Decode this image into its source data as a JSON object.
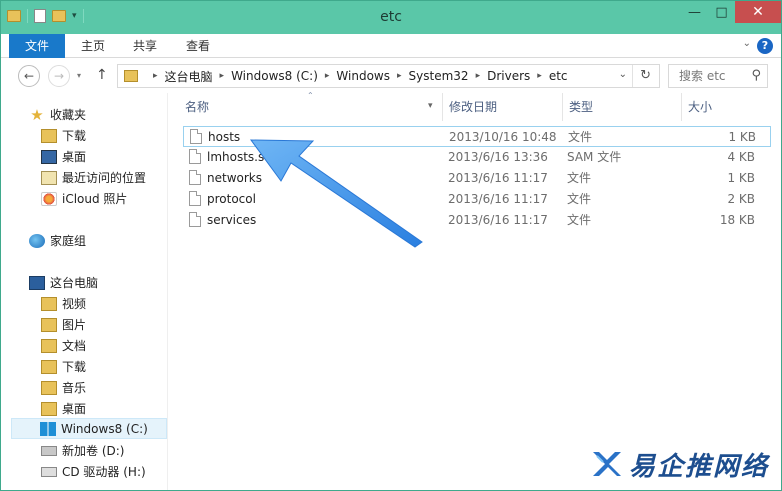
{
  "window": {
    "title": "etc"
  },
  "ribbon": {
    "tabs": [
      "文件",
      "主页",
      "共享",
      "查看"
    ]
  },
  "address": {
    "crumbs": [
      "这台电脑",
      "Windows8 (C:)",
      "Windows",
      "System32",
      "Drivers",
      "etc"
    ],
    "search_placeholder": "搜索 etc"
  },
  "nav": {
    "favorites_label": "收藏夹",
    "favorites": [
      "下载",
      "桌面",
      "最近访问的位置",
      "iCloud 照片"
    ],
    "homegroup_label": "家庭组",
    "pc_label": "这台电脑",
    "pc_items": [
      "视频",
      "图片",
      "文档",
      "下载",
      "音乐",
      "桌面",
      "Windows8 (C:)",
      "新加卷 (D:)",
      "CD 驱动器 (H:)"
    ],
    "selected": "Windows8 (C:)"
  },
  "columns": {
    "name": "名称",
    "date": "修改日期",
    "type": "类型",
    "size": "大小"
  },
  "files": [
    {
      "name": "hosts",
      "date": "2013/10/16 10:48",
      "type": "文件",
      "size": "1 KB"
    },
    {
      "name": "lmhosts.sam",
      "date": "2013/6/16 13:36",
      "type": "SAM 文件",
      "size": "4 KB"
    },
    {
      "name": "networks",
      "date": "2013/6/16 11:17",
      "type": "文件",
      "size": "1 KB"
    },
    {
      "name": "protocol",
      "date": "2013/6/16 11:17",
      "type": "文件",
      "size": "2 KB"
    },
    {
      "name": "services",
      "date": "2013/6/16 11:17",
      "type": "文件",
      "size": "18 KB"
    }
  ],
  "watermark": {
    "text": "易企推网络"
  },
  "colors": {
    "titlebar": "#5ac7a8",
    "file_tab": "#1979ca",
    "arrow": "#3b8fe6",
    "close": "#c74f4f"
  }
}
